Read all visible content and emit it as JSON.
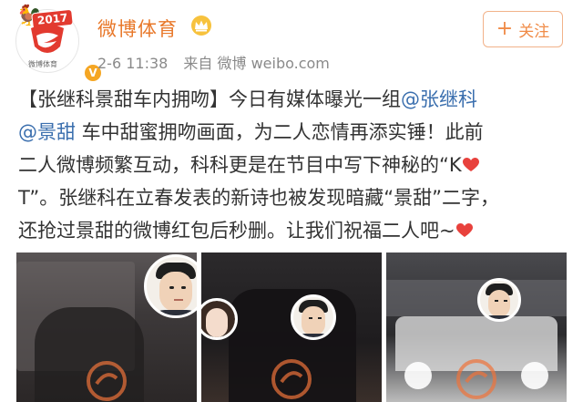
{
  "header": {
    "account_name": "微博体育",
    "avatar_badge": "2017",
    "avatar_caption": "微博体育",
    "verified_icon": "verified-v-icon",
    "timestamp": "2-6 11:38",
    "source": "来自 微博 weibo.com",
    "follow_label": "关注",
    "follow_icon": "plus-icon",
    "accent_color": "#e8782a"
  },
  "post": {
    "line1_prefix": "【张继科景甜车内拥吻】今日有媒体曝光一组",
    "mention1": "@张继科",
    "mention2": "@景甜",
    "line2_rest": " 车中甜蜜拥吻画面，为二人恋情再添实锤！此前",
    "line3": "二人微博频繁互动，科科更是在节目中写下神秘的“K",
    "line4": "T”。张继科在立春发表的新诗也被发现暗藏“景甜”二字，",
    "line5": "还抢过景甜的微博红包后秒删。让我们祝福二人吧~",
    "link_color": "#3b6fae",
    "emoji": "heart-emoji"
  },
  "photos": [
    {
      "name": "photo-1",
      "bubbles": [
        "man-face"
      ]
    },
    {
      "name": "photo-2",
      "bubbles": [
        "woman-face",
        "man-face"
      ]
    },
    {
      "name": "photo-3",
      "bubbles": [
        "man-face"
      ]
    }
  ]
}
